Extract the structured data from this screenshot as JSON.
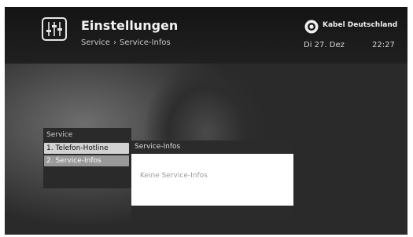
{
  "header": {
    "title": "Einstellungen",
    "breadcrumb": {
      "parent": "Service",
      "separator": "›",
      "current": "Service-Infos"
    },
    "settings_icon": "equalizer-sliders-icon",
    "provider": {
      "name": "Kabel Deutschland",
      "logo_icon": "kabel-deutschland-eye-logo"
    },
    "date": "Di 27. Dez",
    "time": "22:27"
  },
  "menu": {
    "title": "Service",
    "items": [
      {
        "label": "1. Telefon-Hotline",
        "state": "highlighted"
      },
      {
        "label": "2. Service-Infos",
        "state": "selected"
      }
    ]
  },
  "panel": {
    "title": "Service-Infos",
    "message": "Keine Service-Infos"
  },
  "colors": {
    "header_bg": "#1a1a1a",
    "menu_bg": "#2a2a2a",
    "highlight": "#d2d2d2",
    "selected": "#999999",
    "panel_body": "#ffffff"
  }
}
